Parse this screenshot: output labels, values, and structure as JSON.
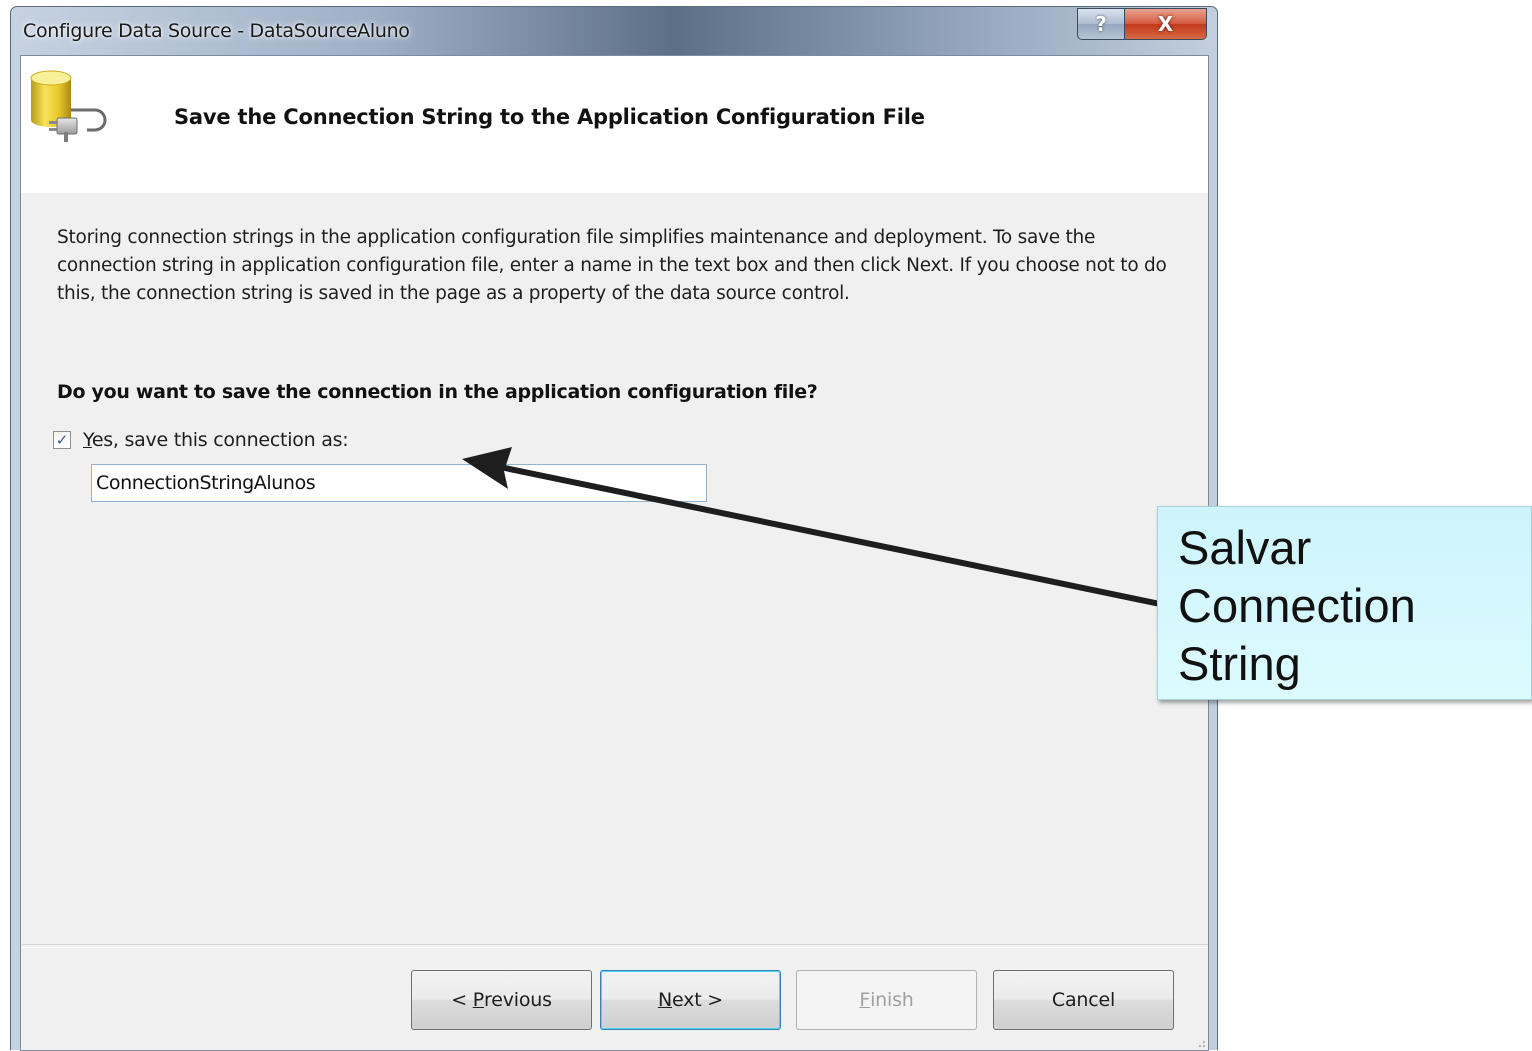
{
  "window": {
    "title": "Configure Data Source - DataSourceAluno",
    "help_glyph": "?",
    "close_glyph": "X"
  },
  "header": {
    "title": "Save the Connection String to the Application Configuration File",
    "icon": "database-plug-icon"
  },
  "description": "Storing connection strings in the application configuration file simplifies maintenance and deployment. To save the connection string in application configuration file, enter a name in the text box and then click Next. If you choose not to do this, the connection string is saved in the page as a property of the data source control.",
  "question": "Do you want to save the connection in the application configuration file?",
  "save_option": {
    "checked": true,
    "check_glyph": "✓",
    "label_mnemonic": "Y",
    "label_rest": "es, save this connection as:",
    "connection_name": "ConnectionStringAlunos"
  },
  "buttons": {
    "previous": {
      "prefix": "< ",
      "mnemonic": "P",
      "rest": "revious"
    },
    "next": {
      "mnemonic": "N",
      "rest": "ext >"
    },
    "finish": {
      "mnemonic": "F",
      "rest": "inish",
      "disabled": true
    },
    "cancel": {
      "label": "Cancel"
    }
  },
  "annotation": {
    "lines": [
      "Salvar",
      "Connection",
      "String"
    ],
    "background": "#d4f7fc"
  },
  "colors": {
    "close_button": "#c2391b",
    "default_button_border": "#3c7fb1",
    "input_border": "#8fb3cf",
    "client_background": "#f0f0f0"
  }
}
